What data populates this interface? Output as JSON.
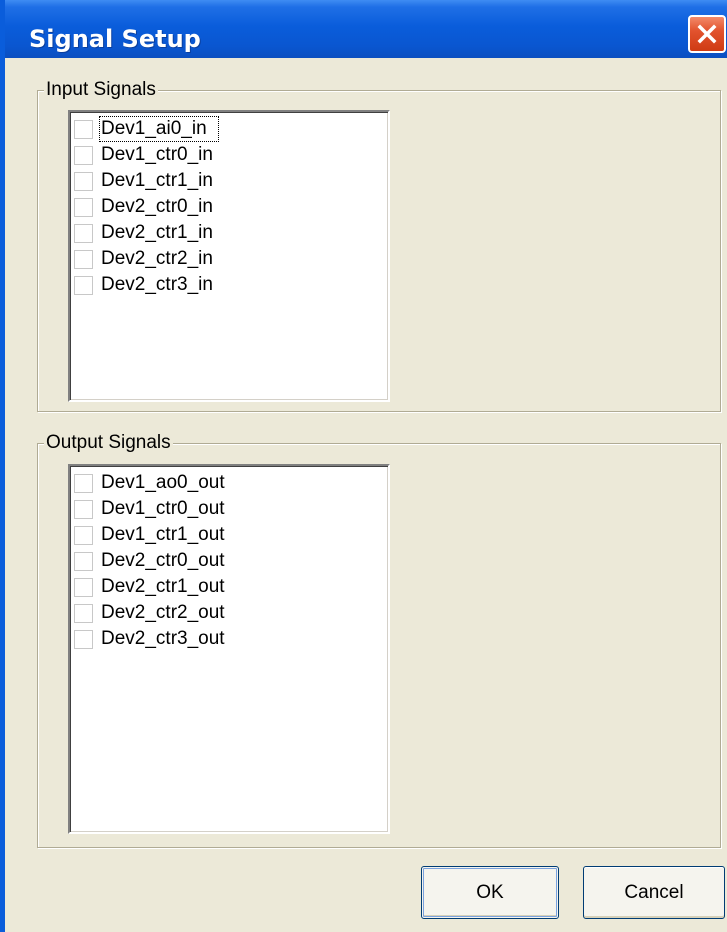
{
  "window": {
    "title": "Signal Setup"
  },
  "input_group": {
    "label": "Input Signals",
    "items": [
      {
        "label": "Dev1_ai0_in",
        "checked": false,
        "focused": true
      },
      {
        "label": "Dev1_ctr0_in",
        "checked": false
      },
      {
        "label": "Dev1_ctr1_in",
        "checked": false
      },
      {
        "label": "Dev2_ctr0_in",
        "checked": false
      },
      {
        "label": "Dev2_ctr1_in",
        "checked": false
      },
      {
        "label": "Dev2_ctr2_in",
        "checked": false
      },
      {
        "label": "Dev2_ctr3_in",
        "checked": false
      }
    ]
  },
  "output_group": {
    "label": "Output Signals",
    "items": [
      {
        "label": "Dev1_ao0_out",
        "checked": false
      },
      {
        "label": "Dev1_ctr0_out",
        "checked": false
      },
      {
        "label": "Dev1_ctr1_out",
        "checked": false
      },
      {
        "label": "Dev2_ctr0_out",
        "checked": false
      },
      {
        "label": "Dev2_ctr1_out",
        "checked": false
      },
      {
        "label": "Dev2_ctr2_out",
        "checked": false
      },
      {
        "label": "Dev2_ctr3_out",
        "checked": false
      }
    ]
  },
  "buttons": {
    "ok_label": "OK",
    "cancel_label": "Cancel"
  },
  "icons": {
    "close": "close-icon"
  },
  "colors": {
    "titlebar": "#0a5ddb",
    "close_button": "#e2532e",
    "dialog_background": "#ece9d8"
  }
}
